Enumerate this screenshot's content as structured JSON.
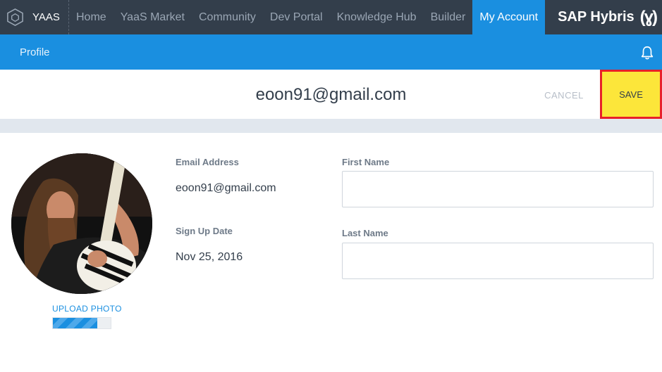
{
  "nav": {
    "brand": "YAAS",
    "items": [
      {
        "label": "Home",
        "active": false
      },
      {
        "label": "YaaS Market",
        "active": false
      },
      {
        "label": "Community",
        "active": false
      },
      {
        "label": "Dev Portal",
        "active": false
      },
      {
        "label": "Knowledge Hub",
        "active": false
      },
      {
        "label": "Builder",
        "active": false
      },
      {
        "label": "My Account",
        "active": true
      }
    ],
    "logo_text": "SAP Hybris",
    "logo_badge": "(ɣ)"
  },
  "subbar": {
    "title": "Profile",
    "icon": "bell-icon"
  },
  "header": {
    "title": "eoon91@gmail.com",
    "cancel_label": "CANCEL",
    "save_label": "SAVE"
  },
  "profile": {
    "upload_label": "UPLOAD PHOTO",
    "upload_progress": 0.77,
    "email_label": "Email Address",
    "email_value": "eoon91@gmail.com",
    "signup_label": "Sign Up Date",
    "signup_value": "Nov 25, 2016",
    "first_name_label": "First Name",
    "first_name_value": "",
    "last_name_label": "Last Name",
    "last_name_value": ""
  },
  "colors": {
    "nav_bg": "#333e4b",
    "accent": "#1a8fe0",
    "save_bg": "#fce63a",
    "save_border": "#e8202a"
  }
}
